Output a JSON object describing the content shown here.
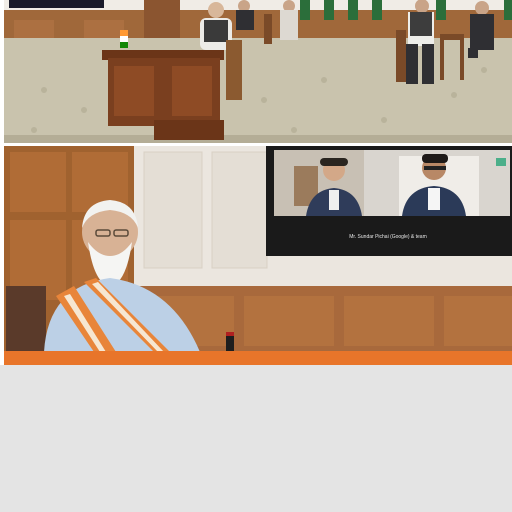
{
  "top_photo": {
    "scene": "formal meeting hall with participants seated facing a screen",
    "colors": {
      "carpet": "#c9c3ad",
      "wall": "#a0683a",
      "desk": "#7a3f1f"
    }
  },
  "bottom_photo": {
    "scene": "smiling man in white kurta and orange-patterned stole watching video call on wall-mounted TV",
    "tv_caption": "Mr. Sundar Pichai (Google) & team",
    "colors": {
      "wall": "#ebe6df",
      "panel": "#a8693c",
      "tv_bezel": "#1a1a1a"
    }
  },
  "accent_bar": {
    "color": "#e8752a"
  },
  "footer_area": {
    "color": "#e4e4e4"
  }
}
